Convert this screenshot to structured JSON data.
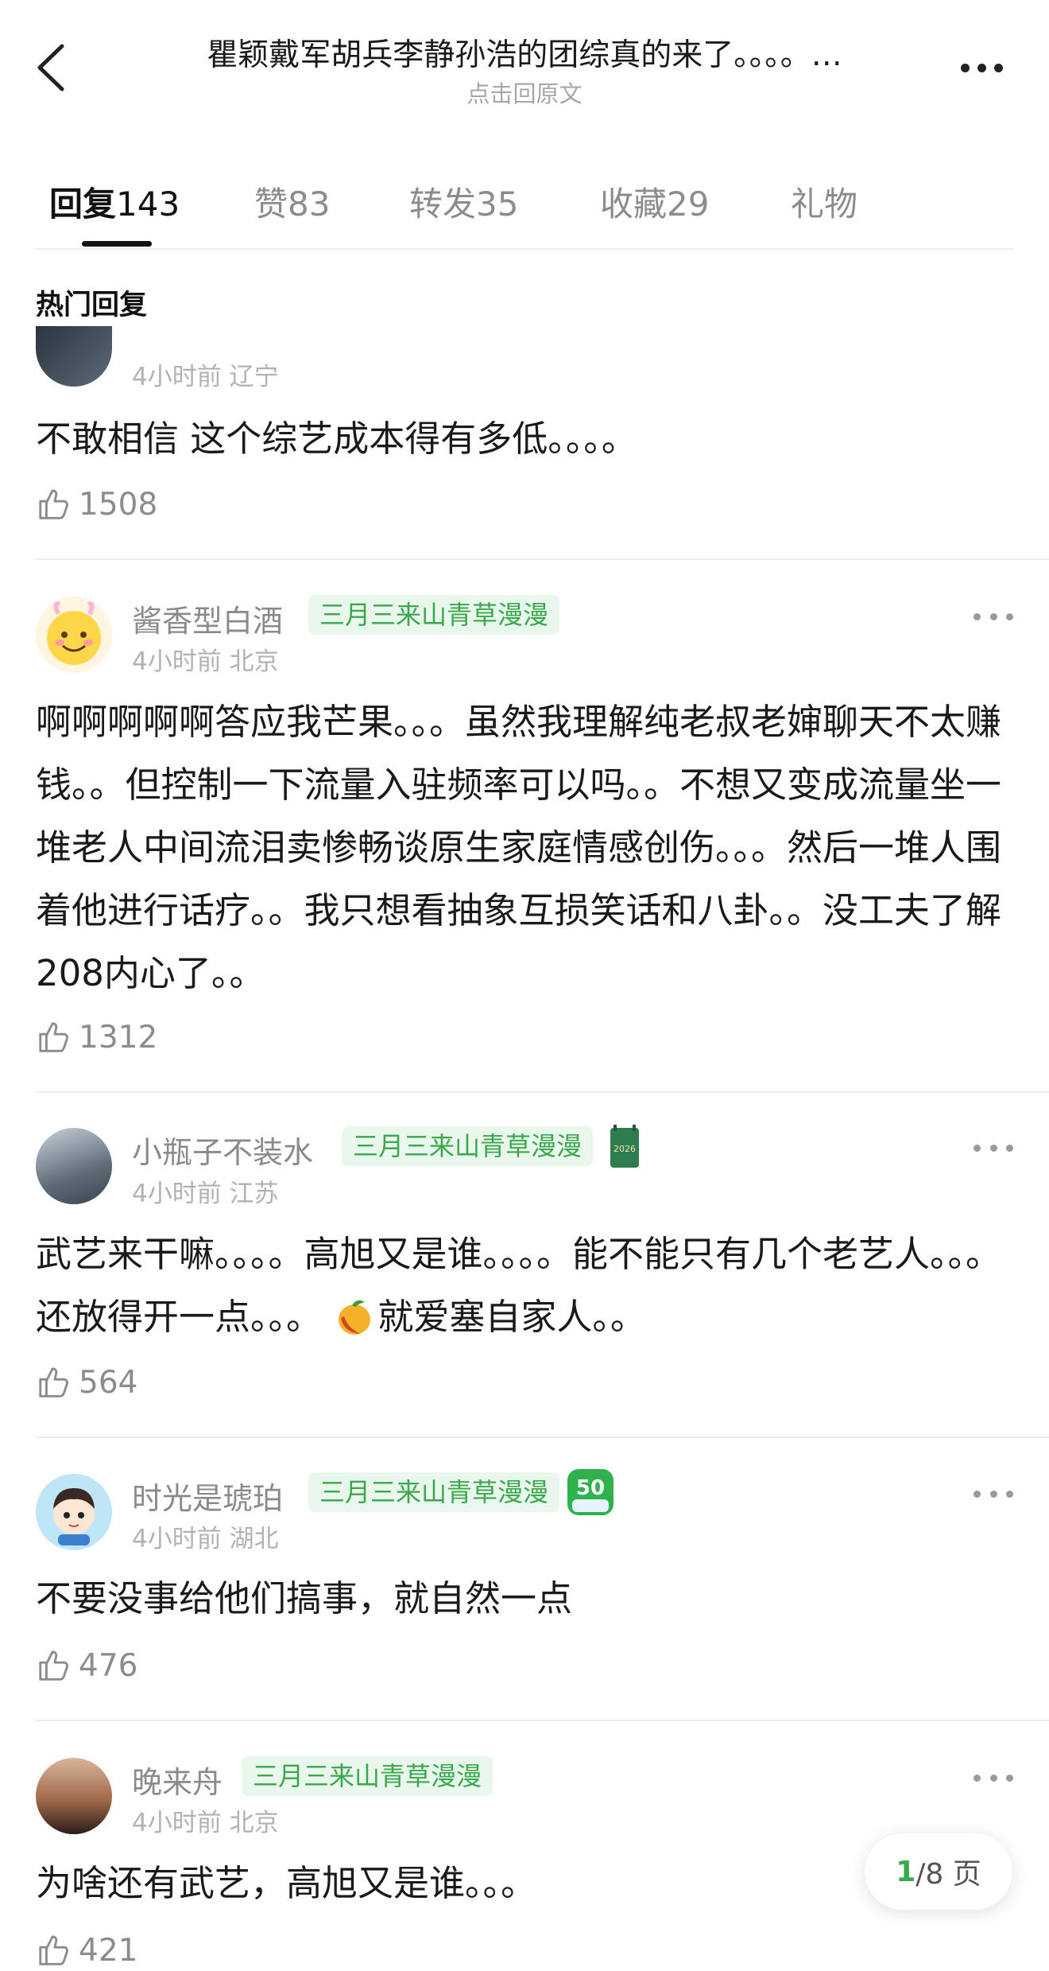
{
  "header": {
    "title": "瞿颖戴军胡兵李静孙浩的团综真的来了。。。。…",
    "subtitle": "点击回原文"
  },
  "tabs": [
    {
      "label": "回复",
      "count": "143"
    },
    {
      "label": "赞",
      "count": "83"
    },
    {
      "label": "转发",
      "count": "35"
    },
    {
      "label": "收藏",
      "count": "29"
    },
    {
      "label": "礼物",
      "count": ""
    }
  ],
  "section_title": "热门回复",
  "comments": [
    {
      "username": "",
      "tag": "",
      "time": "4小时前",
      "location": "辽宁",
      "text": "不敢相信 这个综艺成本得有多低。。。。",
      "likes": "1508"
    },
    {
      "username": "酱香型白酒",
      "tag": "三月三来山青草漫漫",
      "time": "4小时前",
      "location": "北京",
      "text": "啊啊啊啊啊答应我芒果。。。虽然我理解纯老叔老婶聊天不太赚钱。。但控制一下流量入驻频率可以吗。。不想又变成流量坐一堆老人中间流泪卖惨畅谈原生家庭情感创伤。。。然后一堆人围着他进行话疗。。我只想看抽象互损笑话和八卦。。没工夫了解208内心了。。",
      "likes": "1312"
    },
    {
      "username": "小瓶子不装水",
      "tag": "三月三来山青草漫漫",
      "time": "4小时前",
      "location": "江苏",
      "text_before": "武艺来干嘛。。。。高旭又是谁。。。。能不能只有几个老艺人。。。还放得开一点。。。",
      "text_after": "就爱塞自家人。。",
      "badge_text": "2026",
      "likes": "564"
    },
    {
      "username": "时光是琥珀",
      "tag": "三月三来山青草漫漫",
      "time": "4小时前",
      "location": "湖北",
      "text": "不要没事给他们搞事，就自然一点",
      "badge_text": "50",
      "likes": "476"
    },
    {
      "username": "晚来舟",
      "tag": "三月三来山青草漫漫",
      "time": "4小时前",
      "location": "北京",
      "text": "为啥还有武艺，高旭又是谁。。。",
      "likes": "421"
    }
  ],
  "pager": {
    "current": "1",
    "total": "/8 页"
  },
  "colors": {
    "accent": "#3aa84c",
    "tag_bg": "#e9f7ec",
    "meta": "#b2b2b2"
  }
}
